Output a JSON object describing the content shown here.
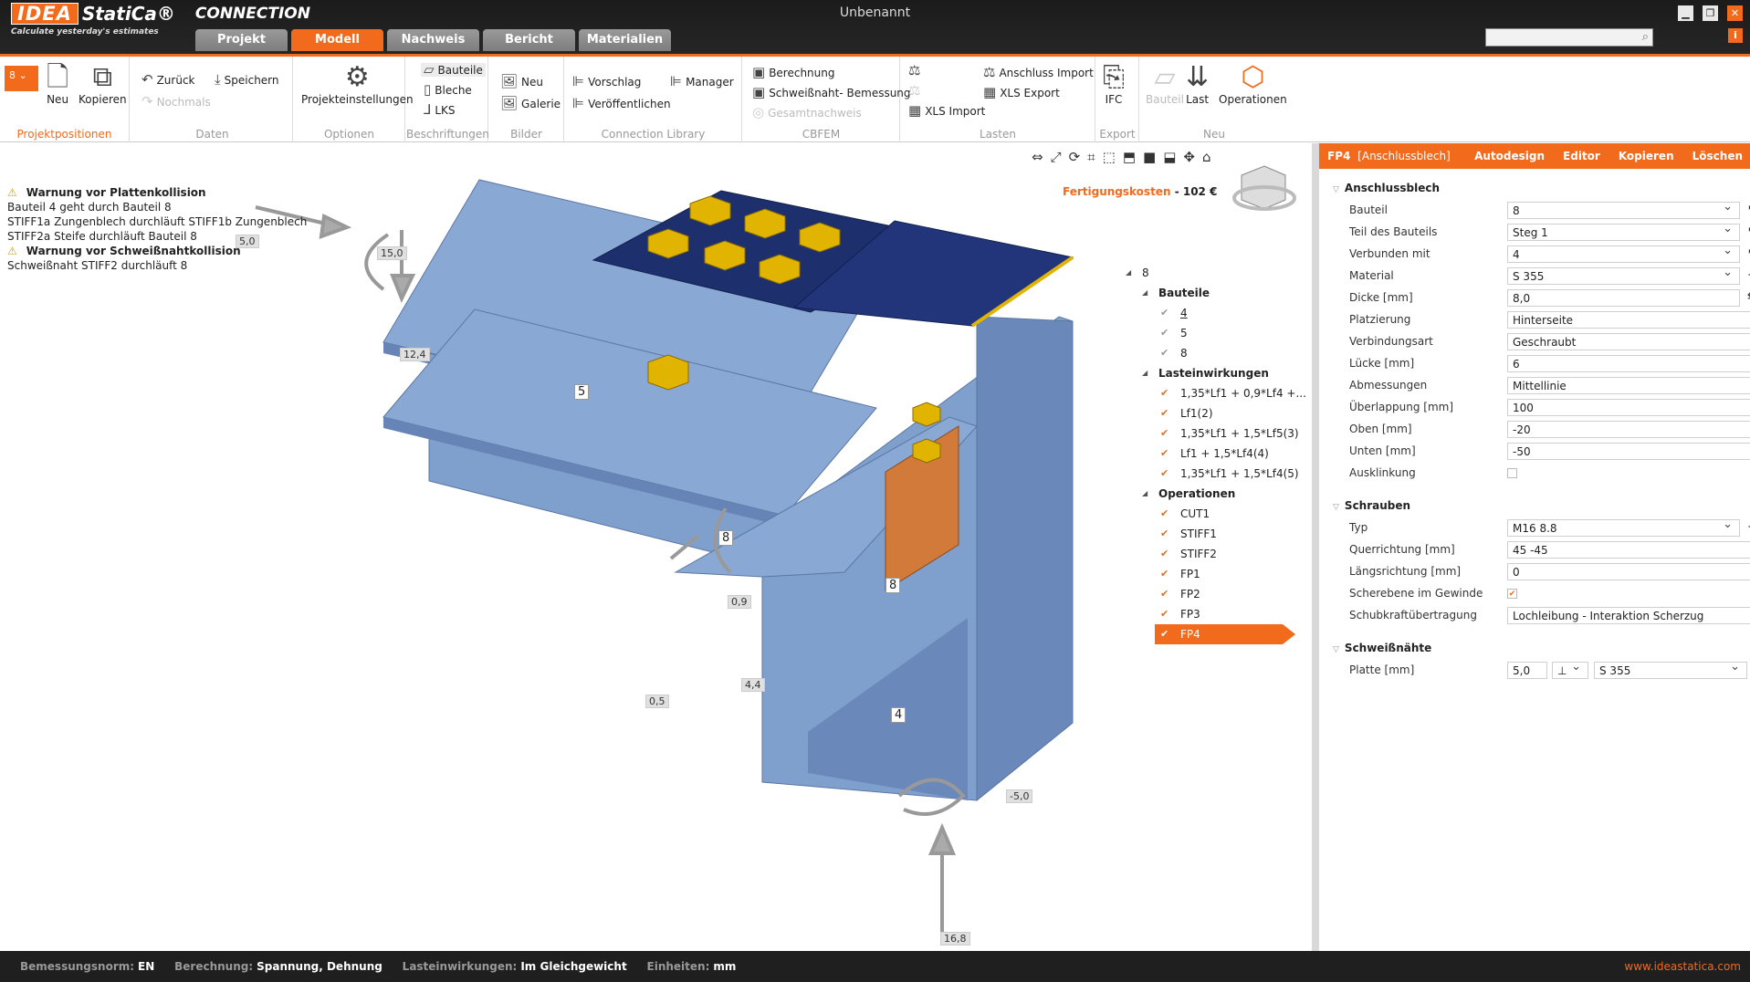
{
  "app": {
    "logo_idea": "IDEA",
    "logo_statica": "StatiCa®",
    "logo_product": "CONNECTION",
    "tagline": "Calculate yesterday's estimates",
    "title": "Unbenannt"
  },
  "tabs": [
    "Projekt",
    "Modell",
    "Nachweis",
    "Bericht",
    "Materialien"
  ],
  "ribbon": {
    "position_value": "8",
    "projektpositionen": {
      "neu": "Neu",
      "kopieren": "Kopieren",
      "label": "Projektpositionen"
    },
    "daten": {
      "zurueck": "Zurück",
      "speichern": "Speichern",
      "nochmals": "Nochmals",
      "label": "Daten"
    },
    "optionen": {
      "projekteinstellungen": "Projekteinstellungen",
      "label": "Optionen"
    },
    "beschriftungen": {
      "bauteile": "Bauteile",
      "bleche": "Bleche",
      "lks": "LKS",
      "label": "Beschriftungen"
    },
    "bilder": {
      "neu": "Neu",
      "galerie": "Galerie",
      "label": "Bilder"
    },
    "library": {
      "vorschlag": "Vorschlag",
      "manager": "Manager",
      "veroeffentlichen": "Veröffentlichen",
      "label": "Connection Library"
    },
    "cbfem": {
      "berechnung": "Berechnung",
      "schweiss": "Schweißnaht- Bemessung",
      "gesamt": "Gesamtnachweis",
      "label": "CBFEM"
    },
    "lasten": {
      "anschluss_import": "Anschluss Import",
      "xls_export": "XLS Export",
      "xls_import": "XLS Import",
      "label": "Lasten"
    },
    "export": {
      "ifc": "IFC",
      "label": "Export"
    },
    "neu": {
      "bauteil": "Bauteil",
      "last": "Last",
      "operationen": "Operationen",
      "label": "Neu"
    }
  },
  "warnings": [
    {
      "title": "Warnung vor Plattenkollision",
      "lines": [
        "Bauteil 4 geht durch Bauteil 8",
        "STIFF1a Zungenblech durchläuft STIFF1b Zungenblech",
        "STIFF2a Steife durchläuft Bauteil 8"
      ]
    },
    {
      "title": "Warnung vor Schweißnahtkollision",
      "lines": [
        "Schweißnaht STIFF2 durchläuft 8"
      ]
    }
  ],
  "cost": {
    "label": "Fertigungskosten",
    "value": "102 €"
  },
  "scene": {
    "dims": [
      "5,0",
      "15,0",
      "12,4",
      "0,9",
      "0,5",
      "4,4",
      "-5,0",
      "16,8"
    ],
    "part_labels": [
      "5",
      "8",
      "8",
      "4"
    ]
  },
  "tree": {
    "root": "8",
    "bauteile_label": "Bauteile",
    "bauteile": [
      "4",
      "5",
      "8"
    ],
    "lasten_label": "Lasteinwirkungen",
    "lasten": [
      "1,35*Lf1 + 0,9*Lf4 +...",
      "Lf1(2)",
      "1,35*Lf1 + 1,5*Lf5(3)",
      "Lf1 + 1,5*Lf4(4)",
      "1,35*Lf1 + 1,5*Lf4(5)"
    ],
    "operationen_label": "Operationen",
    "operationen": [
      "CUT1",
      "STIFF1",
      "STIFF2",
      "FP1",
      "FP2",
      "FP3",
      "FP4"
    ]
  },
  "panel": {
    "header_id": "FP4",
    "header_type": "[Anschlussblech]",
    "actions": [
      "Autodesign",
      "Editor",
      "Kopieren",
      "Löschen"
    ],
    "sec1": "Anschlussblech",
    "bauteil_label": "Bauteil",
    "bauteil": "8",
    "teil_label": "Teil des Bauteils",
    "teil": "Steg 1",
    "verbunden_label": "Verbunden mit",
    "verbunden": "4",
    "material_label": "Material",
    "material": "S 355",
    "dicke_label": "Dicke [mm]",
    "dicke": "8,0",
    "platz_label": "Platzierung",
    "platz": "Hinterseite",
    "verbart_label": "Verbindungsart",
    "verbart": "Geschraubt",
    "luecke_label": "Lücke [mm]",
    "luecke": "6",
    "abm_label": "Abmessungen",
    "abm": "Mittellinie",
    "ueber_label": "Überlappung [mm]",
    "ueber": "100",
    "oben_label": "Oben [mm]",
    "oben": "-20",
    "unten_label": "Unten [mm]",
    "unten": "-50",
    "auskl_label": "Ausklinkung",
    "sec2": "Schrauben",
    "typ_label": "Typ",
    "typ": "M16 8.8",
    "quer_label": "Querrichtung [mm]",
    "quer": "45 -45",
    "laengs_label": "Längsrichtung [mm]",
    "laengs": "0",
    "schere_label": "Scherebene im Gewinde",
    "schub_label": "Schubkraftübertragung",
    "schub": "Lochleibung - Interaktion Scherzug",
    "sec3": "Schweißnähte",
    "platte_label": "Platte [mm]",
    "platte": "5,0",
    "platte_mat": "S 355"
  },
  "status": {
    "norm_label": "Bemessungsnorm:",
    "norm": "EN",
    "ber_label": "Berechnung:",
    "ber": "Spannung, Dehnung",
    "last_label": "Lasteinwirkungen:",
    "last": "Im Gleichgewicht",
    "einh_label": "Einheiten:",
    "einh": "mm",
    "website": "www.ideastatica.com"
  },
  "colors": {
    "accent": "#f26a1b",
    "steel": "#7f9fcc",
    "plate": "#1e2f6e",
    "bolt": "#e0b400"
  }
}
